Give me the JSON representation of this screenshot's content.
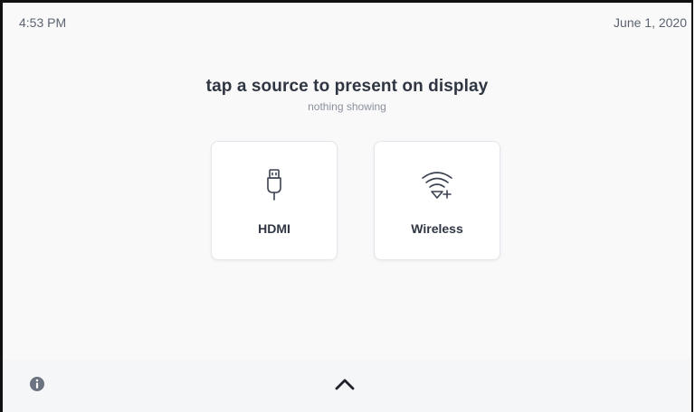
{
  "status_bar": {
    "time": "4:53 PM",
    "date": "June 1, 2020"
  },
  "main": {
    "prompt": "tap a source to present on display",
    "status": "nothing showing",
    "sources": [
      {
        "label": "HDMI",
        "icon": "hdmi-plug-icon"
      },
      {
        "label": "Wireless",
        "icon": "wireless-add-icon"
      }
    ]
  },
  "bottom_bar": {
    "info_icon": "info-icon",
    "expand_icon": "chevron-up-icon"
  },
  "colors": {
    "text_primary": "#2f3642",
    "text_secondary": "#8a919c",
    "status_text": "#5b6470",
    "icon_gray": "#6b7280"
  }
}
